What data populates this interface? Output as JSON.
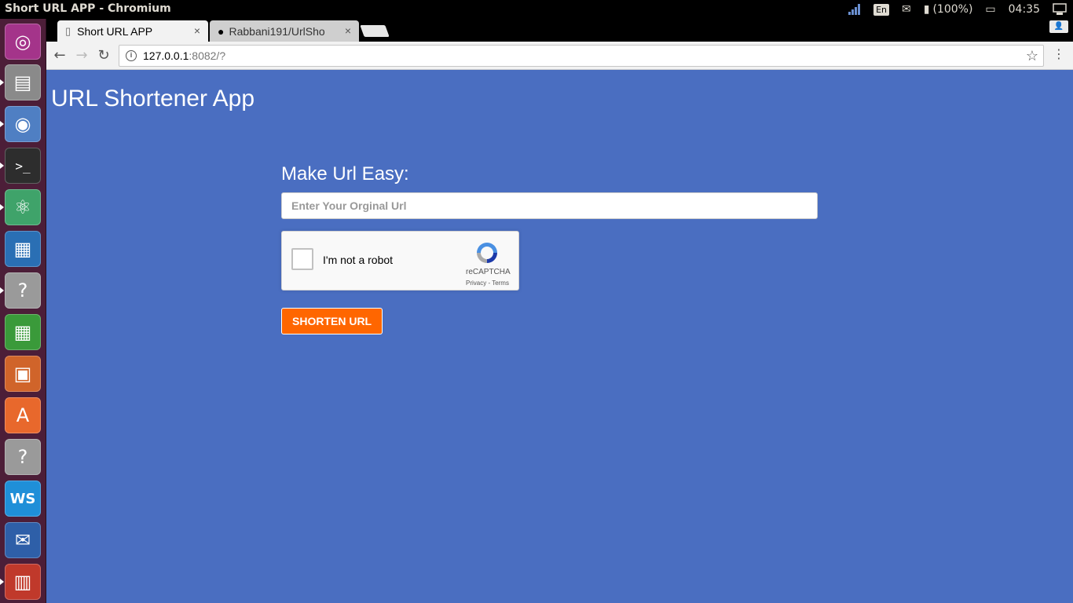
{
  "os": {
    "window_title": "Short URL APP - Chromium",
    "language": "En",
    "battery": "(100%)",
    "clock": "04:35"
  },
  "browser": {
    "tabs": [
      {
        "label": "Short URL APP",
        "active": true
      },
      {
        "label": "Rabbani191/UrlSho",
        "active": false
      }
    ],
    "close_glyph": "×",
    "url_host": "127.0.0.1",
    "url_rest": ":8082/?"
  },
  "page": {
    "app_title": "URL Shortener App",
    "form_heading": "Make Url Easy:",
    "url_placeholder": "Enter Your Orginal Url",
    "recaptcha": {
      "label": "I'm not a robot",
      "brand": "reCAPTCHA",
      "links": "Privacy - Terms"
    },
    "submit_label": "Shorten Url"
  },
  "colors": {
    "page_bg": "#4a6ec1",
    "button_bg": "#ff6600",
    "launcher_bg": "#4c1e38"
  },
  "launcher_icons": [
    "ubuntu-dash-icon",
    "files-icon",
    "chromium-icon",
    "terminal-icon",
    "atom-icon",
    "libreoffice-writer-icon",
    "unknown-app-icon",
    "libreoffice-calc-icon",
    "libreoffice-impress-icon",
    "software-center-icon",
    "unknown-app-icon",
    "webstorm-icon",
    "thunderbird-icon",
    "system-app-icon"
  ]
}
